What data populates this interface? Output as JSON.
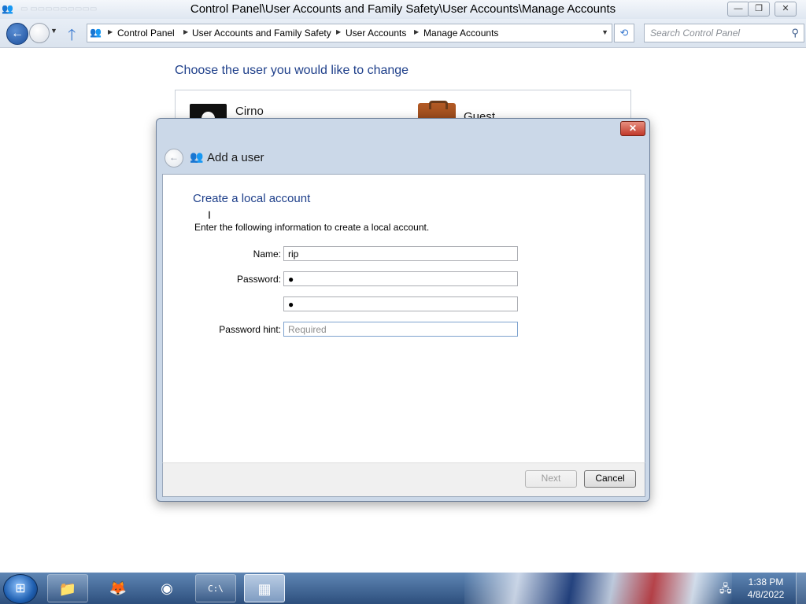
{
  "window": {
    "title": "Control Panel\\User Accounts and Family Safety\\User Accounts\\Manage Accounts",
    "minimize": "—",
    "maximize": "❐",
    "close": "✕"
  },
  "nav": {
    "back_icon": "←",
    "up_icon": "🡑",
    "breadcrumbs": [
      "Control Panel",
      "User Accounts and Family Safety",
      "User Accounts",
      "Manage Accounts"
    ],
    "search_placeholder": "Search Control Panel"
  },
  "page": {
    "heading": "Choose the user you would like to change",
    "users": [
      {
        "name": "Cirno"
      },
      {
        "name": "Guest"
      }
    ]
  },
  "dialog": {
    "title": "Add a user",
    "section_title": "Create a local account",
    "instruction": "Enter the following information to create a local account.",
    "fields": {
      "name_label": "Name:",
      "name_value": "rip",
      "password_label": "Password:",
      "password_value": "●",
      "confirm_value": "●",
      "hint_label": "Password hint:",
      "hint_placeholder": "Required"
    },
    "buttons": {
      "next": "Next",
      "cancel": "Cancel"
    },
    "close": "✕"
  },
  "taskbar": {
    "clock_time": "1:38 PM",
    "clock_date": "4/8/2022",
    "items": [
      {
        "name": "file-explorer-icon",
        "glyph": "📁"
      },
      {
        "name": "firefox-icon",
        "glyph": "🦊"
      },
      {
        "name": "chrome-icon",
        "glyph": "◉"
      },
      {
        "name": "command-prompt-icon",
        "glyph": "C:\\"
      },
      {
        "name": "control-panel-icon",
        "glyph": "▦"
      }
    ]
  }
}
